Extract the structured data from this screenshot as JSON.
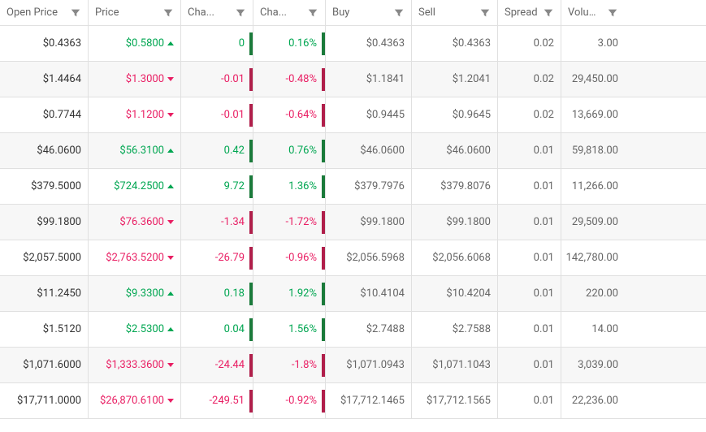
{
  "headers": {
    "open": "Open Price",
    "price": "Price",
    "change": "Cha...",
    "changep": "Cha...",
    "buy": "Buy",
    "sell": "Sell",
    "spread": "Spread",
    "volume": "Volume"
  },
  "colors": {
    "up": "#00a651",
    "down": "#e91e63",
    "bar_up": "#1a7a3a",
    "bar_down": "#b01e4a"
  },
  "rows": [
    {
      "open": "$0.4363",
      "price": "$0.5800",
      "dir": "up",
      "change": "0",
      "changep": "0.16%",
      "buy": "$0.4363",
      "sell": "$0.4363",
      "spread": "0.02",
      "volume": "3.00"
    },
    {
      "open": "$1.4464",
      "price": "$1.3000",
      "dir": "down",
      "change": "-0.01",
      "changep": "-0.48%",
      "buy": "$1.1841",
      "sell": "$1.2041",
      "spread": "0.02",
      "volume": "29,450.00"
    },
    {
      "open": "$0.7744",
      "price": "$1.1200",
      "dir": "down",
      "change": "-0.01",
      "changep": "-0.64%",
      "buy": "$0.9445",
      "sell": "$0.9645",
      "spread": "0.02",
      "volume": "13,669.00"
    },
    {
      "open": "$46.0600",
      "price": "$56.3100",
      "dir": "up",
      "change": "0.42",
      "changep": "0.76%",
      "buy": "$46.0600",
      "sell": "$46.0600",
      "spread": "0.01",
      "volume": "59,818.00"
    },
    {
      "open": "$379.5000",
      "price": "$724.2500",
      "dir": "up",
      "change": "9.72",
      "changep": "1.36%",
      "buy": "$379.7976",
      "sell": "$379.8076",
      "spread": "0.01",
      "volume": "11,266.00"
    },
    {
      "open": "$99.1800",
      "price": "$76.3600",
      "dir": "down",
      "change": "-1.34",
      "changep": "-1.72%",
      "buy": "$99.1800",
      "sell": "$99.1800",
      "spread": "0.01",
      "volume": "29,509.00"
    },
    {
      "open": "$2,057.5000",
      "price": "$2,763.5200",
      "dir": "down",
      "change": "-26.79",
      "changep": "-0.96%",
      "buy": "$2,056.5968",
      "sell": "$2,056.6068",
      "spread": "0.01",
      "volume": "142,780.00"
    },
    {
      "open": "$11.2450",
      "price": "$9.3300",
      "dir": "up",
      "change": "0.18",
      "changep": "1.92%",
      "buy": "$10.4104",
      "sell": "$10.4204",
      "spread": "0.01",
      "volume": "220.00"
    },
    {
      "open": "$1.5120",
      "price": "$2.5300",
      "dir": "up",
      "change": "0.04",
      "changep": "1.56%",
      "buy": "$2.7488",
      "sell": "$2.7588",
      "spread": "0.01",
      "volume": "14.00"
    },
    {
      "open": "$1,071.6000",
      "price": "$1,333.3600",
      "dir": "down",
      "change": "-24.44",
      "changep": "-1.8%",
      "buy": "$1,071.0943",
      "sell": "$1,071.1043",
      "spread": "0.01",
      "volume": "3,039.00"
    },
    {
      "open": "$17,711.0000",
      "price": "$26,870.6100",
      "dir": "down",
      "change": "-249.51",
      "changep": "-0.92%",
      "buy": "$17,712.1465",
      "sell": "$17,712.1565",
      "spread": "0.01",
      "volume": "22,236.00"
    }
  ]
}
